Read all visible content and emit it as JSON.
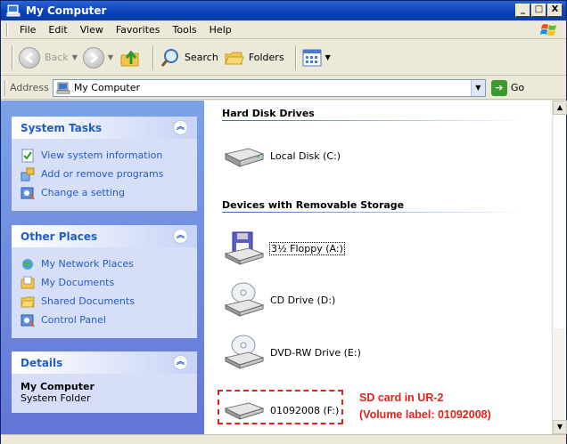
{
  "window": {
    "title": "My Computer"
  },
  "title_buttons": [
    "_",
    "□",
    "X"
  ],
  "menu": [
    "File",
    "Edit",
    "View",
    "Favorites",
    "Tools",
    "Help"
  ],
  "toolbar": {
    "back": "Back",
    "search": "Search",
    "folders": "Folders"
  },
  "address": {
    "label": "Address",
    "value": "My Computer",
    "go": "Go"
  },
  "left": {
    "system_tasks": {
      "title": "System Tasks",
      "items": [
        "View system information",
        "Add or remove programs",
        "Change a setting"
      ]
    },
    "other_places": {
      "title": "Other Places",
      "items": [
        "My Network Places",
        "My Documents",
        "Shared Documents",
        "Control Panel"
      ]
    },
    "details": {
      "title": "Details",
      "name": "My Computer",
      "type": "System Folder"
    }
  },
  "right": {
    "hard_disk_drives": {
      "title": "Hard Disk Drives",
      "drives": [
        "Local Disk (C:)"
      ]
    },
    "removable": {
      "title": "Devices with Removable Storage",
      "drives": [
        "3½ Floppy (A:)",
        "CD Drive (D:)",
        "DVD-RW Drive (E:)",
        "01092008 (F:)"
      ]
    }
  },
  "annotation": {
    "line1": "SD card in UR-2",
    "line2": "(Volume label: 01092008)",
    "color": "#e2231a"
  }
}
